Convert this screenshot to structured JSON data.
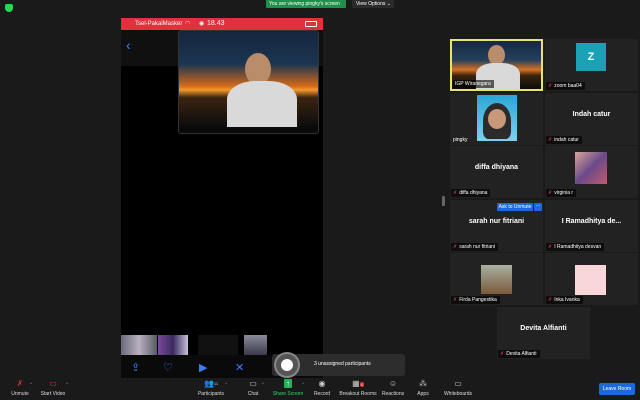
{
  "banner": {
    "text": "You are viewing pingky's screen"
  },
  "view_options": {
    "label": "View Options ⌄"
  },
  "phone": {
    "carrier": "Tsel-PakaiMasker",
    "time": "18.43",
    "toolbar_icons": [
      "share-icon",
      "heart-icon",
      "play-icon",
      "mute-icon",
      "trash-icon"
    ]
  },
  "tiles": [
    {
      "name": "IGP Wiranegara",
      "type": "video",
      "active": true
    },
    {
      "name": "zoom baa04",
      "type": "avatar",
      "avatar_letter": "Z"
    },
    {
      "name": "pingky",
      "type": "video"
    },
    {
      "name": "indah catur",
      "type": "name",
      "display": "Indah catur"
    },
    {
      "name": "diffa dhiyana",
      "type": "name",
      "display": "diffa dhiyana"
    },
    {
      "name": "virginia r",
      "type": "photo"
    },
    {
      "name": "sarah nur fitriani",
      "type": "name",
      "display": "sarah nur fitriani"
    },
    {
      "name": "I Ramadhitya desvan",
      "type": "name",
      "display": "I Ramadhitya de..."
    },
    {
      "name": "Firda Pangestika",
      "type": "photo"
    },
    {
      "name": "Inka Ivanka",
      "type": "photo"
    },
    {
      "name": "Devita Alfianti",
      "type": "name",
      "display": "Devita Alfianti"
    }
  ],
  "ask_to_unmute": "Ask to Unmute",
  "more_label": "···",
  "popup": {
    "text": "3 unassigned participants"
  },
  "toolbar": {
    "unmute": "Unmute",
    "start_video": "Start Video",
    "participants": "Participants",
    "participants_count": "11",
    "chat": "Chat",
    "share_screen": "Share Screen",
    "record": "Record",
    "breakout_rooms": "Breakout Rooms",
    "reactions": "Reactions",
    "apps": "Apps",
    "whiteboards": "Whiteboards",
    "leave": "Leave Room"
  },
  "colors": {
    "accent": "#1a6ad8",
    "active_border": "#e8e36b",
    "share_green": "#1fb35a",
    "muted_red": "#e03333"
  }
}
